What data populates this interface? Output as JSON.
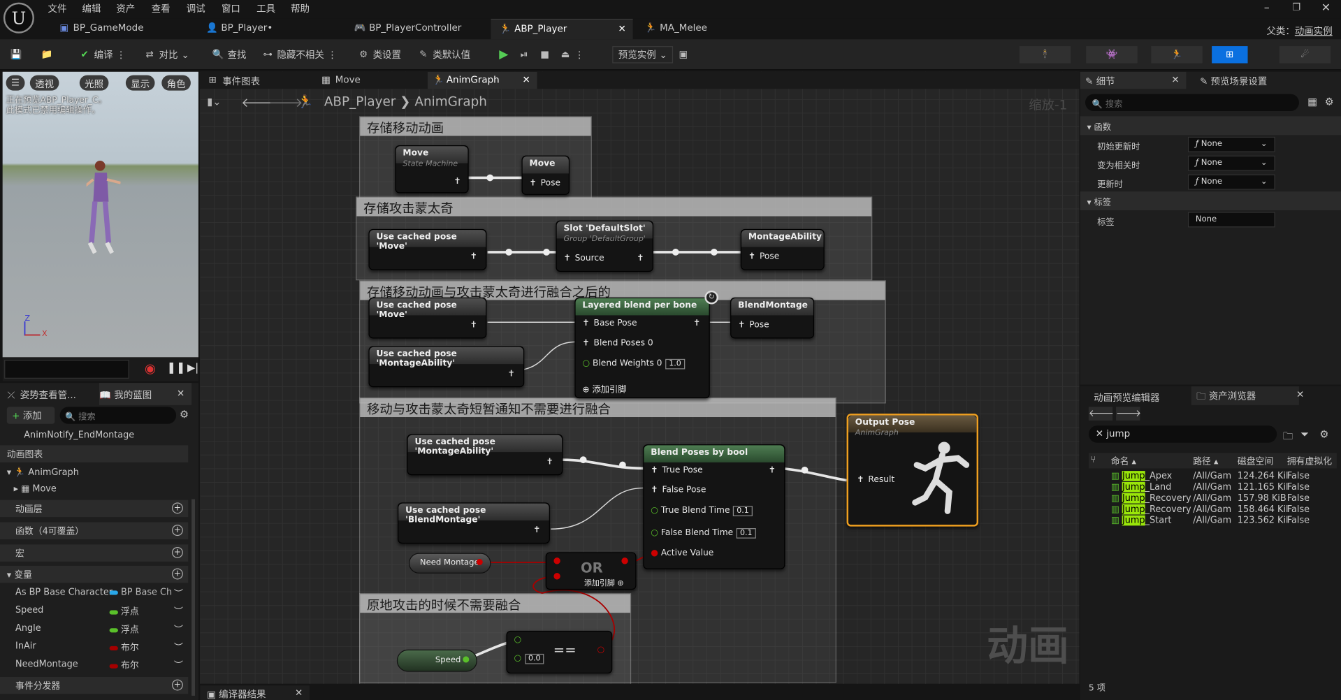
{
  "menu": [
    "文件",
    "编辑",
    "资产",
    "查看",
    "调试",
    "窗口",
    "工具",
    "帮助"
  ],
  "tabs": [
    {
      "label": "BP_GameMode"
    },
    {
      "label": "BP_Player•"
    },
    {
      "label": "BP_PlayerController"
    },
    {
      "label": "ABP_Player"
    },
    {
      "label": "MA_Melee"
    }
  ],
  "parent_class": {
    "label": "父类：",
    "value": "动画实例"
  },
  "toolbar": {
    "compile": "编译",
    "diff": "对比",
    "find": "查找",
    "hide_unrelated": "隐藏不相关",
    "class_settings": "类设置",
    "class_defaults": "类默认值",
    "preview_instance": "预览实例"
  },
  "viewport": {
    "buttons": [
      "透视",
      "光照",
      "显示",
      "角色"
    ],
    "message": "正在预览ABP_Player_C。\n此模式已禁用编辑操作。",
    "axis_z": "Z",
    "axis_x": "X"
  },
  "left_panel": {
    "tab_pose": "姿势查看管...",
    "tab_blueprint": "我的蓝图",
    "add": "添加",
    "search_placeholder": "搜索",
    "notify": "AnimNotify_EndMontage",
    "sect_anim_graphs": "动画图表",
    "animgraph": "AnimGraph",
    "move": "Move",
    "sect_layers": "动画层",
    "sect_functions": "函数（4可覆盖）",
    "sect_macros": "宏",
    "sect_variables": "变量",
    "variables": [
      {
        "name": "As BP Base Character",
        "type": "BP Base Ch"
      },
      {
        "name": "Speed",
        "type": "浮点"
      },
      {
        "name": "Angle",
        "type": "浮点"
      },
      {
        "name": "InAir",
        "type": "布尔"
      },
      {
        "name": "NeedMontage",
        "type": "布尔"
      }
    ],
    "sect_dispatchers": "事件分发器"
  },
  "graph": {
    "tabs": [
      "事件图表",
      "Move",
      "AnimGraph"
    ],
    "breadcrumb": [
      "ABP_Player",
      "AnimGraph"
    ],
    "zoom": "缩放-1",
    "watermark": "动画",
    "comments": [
      "存储移动动画",
      "存储攻击蒙太奇",
      "存储移动动画与攻击蒙太奇进行融合之后的",
      "移动与攻击蒙太奇短暂通知不需要进行融合",
      "原地攻击的时候不需要融合"
    ],
    "nodes": {
      "move_sm": {
        "title": "Move",
        "sub": "State Machine"
      },
      "save_move": {
        "title": "Move",
        "pin": "Pose"
      },
      "use_move1": {
        "title": "Use cached pose 'Move'"
      },
      "slot": {
        "title": "Slot 'DefaultSlot'",
        "sub": "Group 'DefaultGroup'",
        "pin": "Source"
      },
      "montage_ability": {
        "title": "MontageAbility",
        "pin": "Pose"
      },
      "use_move2": {
        "title": "Use cached pose 'Move'"
      },
      "use_ma1": {
        "title": "Use cached pose 'MontageAbility'"
      },
      "layered": {
        "title": "Layered blend per bone",
        "base": "Base Pose",
        "blend_poses": "Blend Poses 0",
        "weights": "Blend Weights 0",
        "weights_val": "1.0",
        "add_pin": "添加引脚"
      },
      "blend_montage": {
        "title": "BlendMontage",
        "pin": "Pose"
      },
      "use_ma2": {
        "title": "Use cached pose 'MontageAbility'"
      },
      "use_bm": {
        "title": "Use cached pose 'BlendMontage'"
      },
      "need_montage": {
        "title": "Need Montage"
      },
      "or": {
        "title": "OR",
        "add_pin": "添加引脚"
      },
      "blend_bool": {
        "title": "Blend Poses by bool",
        "true_pose": "True Pose",
        "false_pose": "False Pose",
        "true_time": "True Blend Time",
        "true_time_val": "0.1",
        "false_time": "False Blend Time",
        "false_time_val": "0.1",
        "active": "Active Value"
      },
      "output": {
        "title": "Output Pose",
        "sub": "AnimGraph",
        "pin": "Result"
      },
      "speed": {
        "title": "Speed"
      },
      "eq": {
        "op": "==",
        "val": "0.0"
      }
    }
  },
  "compiler_tab": "编译器结果",
  "details": {
    "tab_details": "细节",
    "tab_preview": "预览场景设置",
    "search_placeholder": "搜索",
    "sect_functions": "函数",
    "rows": [
      {
        "label": "初始更新时",
        "value": "None"
      },
      {
        "label": "变为相关时",
        "value": "None"
      },
      {
        "label": "更新时",
        "value": "None"
      }
    ],
    "sect_tags": "标签",
    "tag_label": "标签",
    "tag_value": "None"
  },
  "asset_browser": {
    "tab_preview_editor": "动画预览编辑器",
    "tab_assets": "资产浏览器",
    "search": "jump",
    "columns": [
      "命名",
      "路径",
      "磁盘空间",
      "拥有虚拟化"
    ],
    "rows": [
      {
        "hl": "Jump",
        "rest": "_Apex",
        "path": "/All/Gam",
        "size": "124.264 Kil",
        "virt": "False"
      },
      {
        "hl": "Jump",
        "rest": "_Land",
        "path": "/All/Gam",
        "size": "121.165 Kil",
        "virt": "False"
      },
      {
        "hl": "Jump",
        "rest": "_Recovery",
        "path": "/All/Gam",
        "size": "157.98 KiB",
        "virt": "False"
      },
      {
        "hl": "Jump",
        "rest": "_Recovery",
        "path": "/All/Gam",
        "size": "158.464 Kil",
        "virt": "False"
      },
      {
        "hl": "Jump",
        "rest": "_Start",
        "path": "/All/Gam",
        "size": "123.562 Kil",
        "virt": "False"
      }
    ],
    "count": "5 项"
  }
}
